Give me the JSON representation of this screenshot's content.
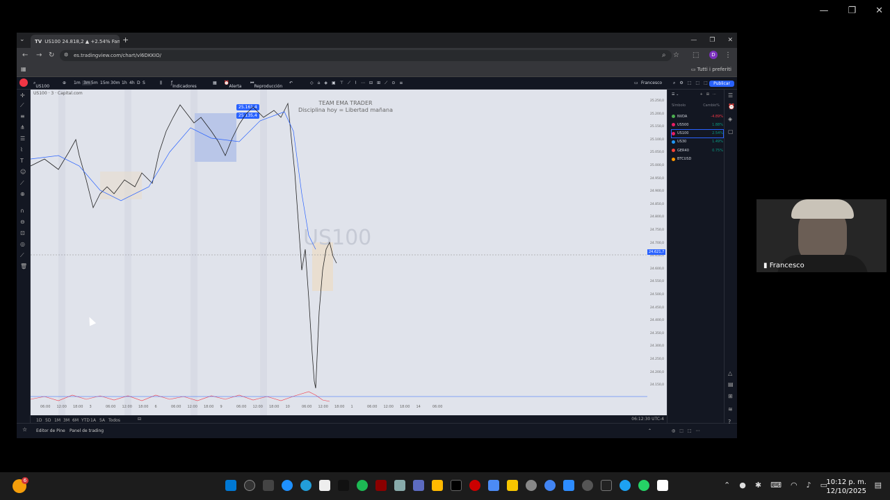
{
  "window": {
    "minimize": "—",
    "maximize": "❐",
    "close": "✕"
  },
  "browser": {
    "tab_title": "US100 24.818,2 ▲ +2.54% Fan",
    "url": "es.tradingview.com/chart/vl6DKKIO/",
    "bookmarks_label": "Tutti i preferiti",
    "profile_initial": "D"
  },
  "tv": {
    "symbol_search": "US100",
    "timeframes": [
      "1m",
      "3m",
      "5m",
      "15m",
      "30m",
      "1h",
      "4h",
      "D",
      "S"
    ],
    "indicators_label": "Indicadores",
    "alert_label": "Alerta",
    "replay_label": "Reproducción",
    "user_label": "Francesco",
    "publish_label": "Publicar",
    "chart_symbol_label": "US100 · 3 · Capital.com",
    "team_title": "TEAM EMA TRADER",
    "team_subtitle": "Disciplina hoy = Libertad mañana",
    "watermark": "US100",
    "price_tag_1": "25.161,4",
    "price_tag_2": "25.135,4",
    "price_ticks": [
      "25.250,0",
      "25.200,0",
      "25.150,0",
      "25.100,0",
      "25.050,0",
      "25.000,0",
      "24.950,0",
      "24.900,0",
      "24.850,0",
      "24.800,0",
      "24.750,0",
      "24.700,0",
      "24.650,0",
      "24.600,0",
      "24.550,0",
      "24.500,0",
      "24.450,0",
      "24.400,0",
      "24.350,0",
      "24.300,0",
      "24.250,0",
      "24.200,0",
      "24.150,0"
    ],
    "current_price": "24.621,7",
    "time_ticks": [
      "06:00",
      "12:00",
      "18:00",
      "3",
      "06:00",
      "12:00",
      "18:00",
      "6",
      "06:00",
      "12:00",
      "18:00",
      "9",
      "06:00",
      "12:00",
      "18:00",
      "10",
      "06:00",
      "12:00",
      "18:00",
      "1",
      "06:00",
      "12:00",
      "18:00",
      "14",
      "06:00"
    ],
    "range_buttons": [
      "1D",
      "5D",
      "1M",
      "3M",
      "6M",
      "YTD",
      "1A",
      "5A",
      "Todos"
    ],
    "clock_text": "06:12:30 UTC-4",
    "footer_left": "Editor de Pine",
    "footer_mid": "Panel de trading",
    "watchlist_header_sym": "Símbolo",
    "watchlist_header_chg": "Cambio%",
    "watchlist": [
      {
        "sym": "NVDA",
        "chg": "-4.89%",
        "color": "#4caf50",
        "chg_color": "#f23645"
      },
      {
        "sym": "US500",
        "chg": "1.88%",
        "color": "#e91e63",
        "chg_color": "#089981"
      },
      {
        "sym": "US100",
        "chg": "2.54%",
        "color": "#e91e63",
        "chg_color": "#089981"
      },
      {
        "sym": "US30",
        "chg": "1.49%",
        "color": "#2196f3",
        "chg_color": "#089981"
      },
      {
        "sym": "GER40",
        "chg": "0.75%",
        "color": "#f44336",
        "chg_color": "#089981"
      },
      {
        "sym": "BTCUSD",
        "chg": "",
        "color": "#ff9800",
        "chg_color": "#f23645"
      }
    ]
  },
  "cam": {
    "name": "Francesco"
  },
  "taskbar": {
    "time": "10:12 p. m.",
    "date": "12/10/2025",
    "badge": "6"
  }
}
